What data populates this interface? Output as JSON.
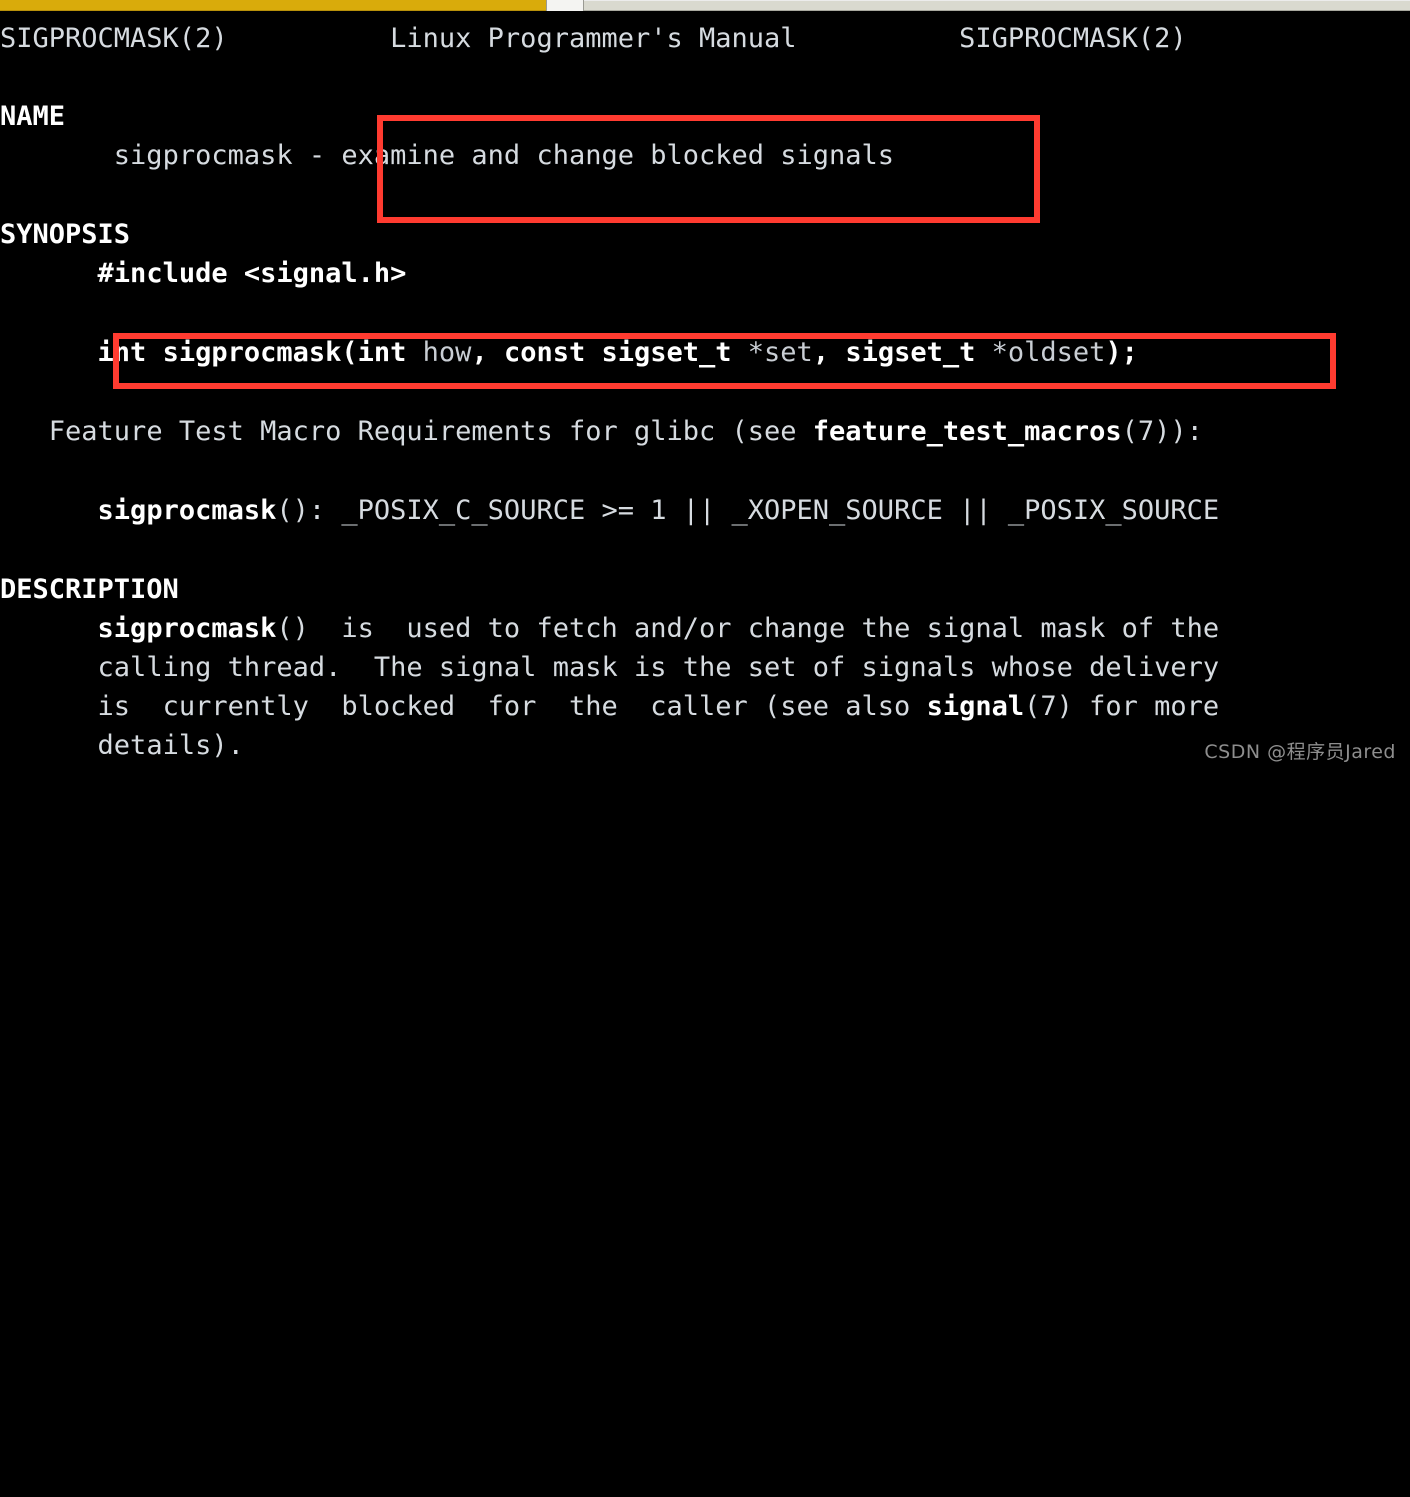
{
  "window": {
    "top_bar": {
      "accent_color": "#d9ab0b",
      "tab_color": "#f4f4f2",
      "bar_color": "#d9d9cf"
    }
  },
  "terminal": {
    "background_color": "#000000",
    "foreground_color": "#d6dbe0",
    "manpage": {
      "header": {
        "left": "SIGPROCMASK(2)",
        "center": "Linux Programmer's Manual",
        "right": "SIGPROCMASK(2)"
      },
      "sections": {
        "name": {
          "heading": "NAME",
          "subject": "sigprocmask - ",
          "summary": "examine and change blocked signals"
        },
        "synopsis": {
          "heading": "SYNOPSIS",
          "include": "#include <signal.h>",
          "prototype": {
            "part1_bold": "int sigprocmask(int",
            "part2_plain": " how",
            "part3_bold": ", const sigset_t",
            "part4_plain": " *set",
            "part5_bold": ", sigset_t",
            "part6_plain": " *oldset",
            "part7_bold": ");"
          },
          "ftm_prefix": "Feature Test Macro Requirements for glibc (see ",
          "ftm_bold": "feature_test_macros",
          "ftm_suffix": "(7)):",
          "posix_bold": "sigprocmask",
          "posix_rest": "(): _POSIX_C_SOURCE >= 1 || _XOPEN_SOURCE || _POSIX_SOURCE"
        },
        "description": {
          "heading": "DESCRIPTION",
          "line1_bold": "sigprocmask",
          "line1_rest": "()  is  used to fetch and/or change the signal mask of the",
          "line2": "calling thread.  The signal mask is the set of signals whose delivery",
          "line3_a": "is  currently  blocked  for  the  caller (see also ",
          "line3_bold": "signal",
          "line3_b": "(7) for more",
          "line4": "details)."
        }
      }
    }
  },
  "annotations": {
    "box_color": "#ff3b30",
    "boxes": [
      {
        "label": "name-summary-highlight"
      },
      {
        "label": "prototype-highlight"
      }
    ]
  },
  "watermark": {
    "text": "CSDN @程序员Jared"
  }
}
